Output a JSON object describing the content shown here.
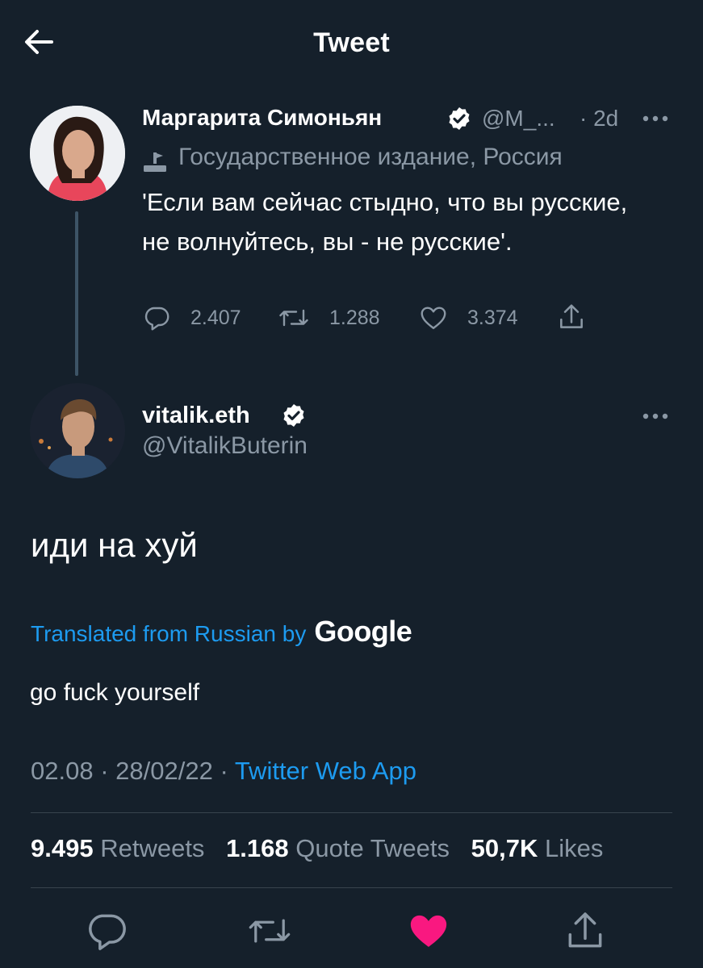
{
  "header": {
    "title": "Tweet"
  },
  "parent_tweet": {
    "name": "Маргарита Симоньян",
    "handle": "@M_...",
    "time": "· 2d",
    "label": "Государственное издание, Россия",
    "text": "'Если вам сейчас стыдно, что вы русские, не волнуйтесь, вы - не русские'.",
    "replies": "2.407",
    "retweets": "1.288",
    "likes": "3.374"
  },
  "main_tweet": {
    "name": "vitalik.eth",
    "handle": "@VitalikButerin",
    "text": "иди на хуй",
    "translated_label": "Translated from Russian by",
    "translator": "Google",
    "translation": "go fuck yourself",
    "time": "02.08",
    "date": "28/02/22",
    "source": "Twitter Web App",
    "stats": {
      "retweets_count": "9.495",
      "retweets_label": "Retweets",
      "quotes_count": "1.168",
      "quotes_label": "Quote Tweets",
      "likes_count": "50,7K",
      "likes_label": "Likes"
    }
  },
  "colors": {
    "background": "#15202b",
    "accent": "#1d9bf0",
    "muted": "#8b98a5",
    "like": "#f91880"
  },
  "icons": [
    "back-arrow-icon",
    "verified-badge-icon",
    "more-icon",
    "state-media-icon",
    "reply-icon",
    "retweet-icon",
    "like-icon",
    "share-icon"
  ]
}
